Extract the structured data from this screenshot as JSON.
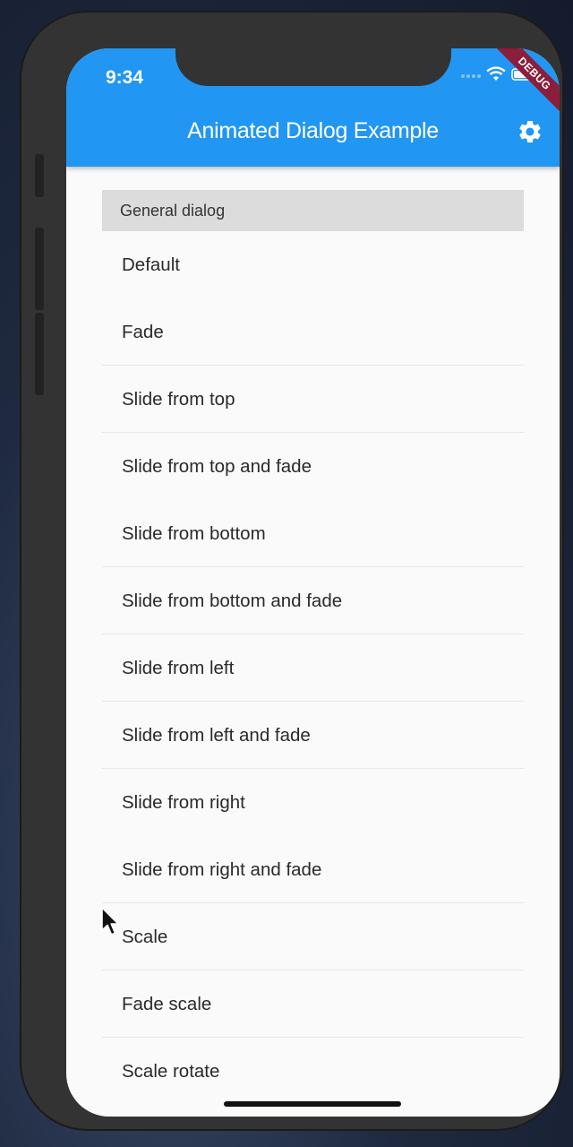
{
  "status_bar": {
    "time": "9:34"
  },
  "app_bar": {
    "title": "Animated Dialog Example",
    "settings_icon": "gear-icon",
    "color": "#2196f3"
  },
  "debug_banner": {
    "label": "DEBUG"
  },
  "list": {
    "section_header": "General dialog",
    "items": [
      "Default",
      "Fade",
      "Slide from top",
      "Slide from top and fade",
      "Slide from bottom",
      "Slide from bottom and fade",
      "Slide from left",
      "Slide from left and fade",
      "Slide from right",
      "Slide from right and fade",
      "Scale",
      "Fade scale",
      "Scale rotate"
    ]
  }
}
